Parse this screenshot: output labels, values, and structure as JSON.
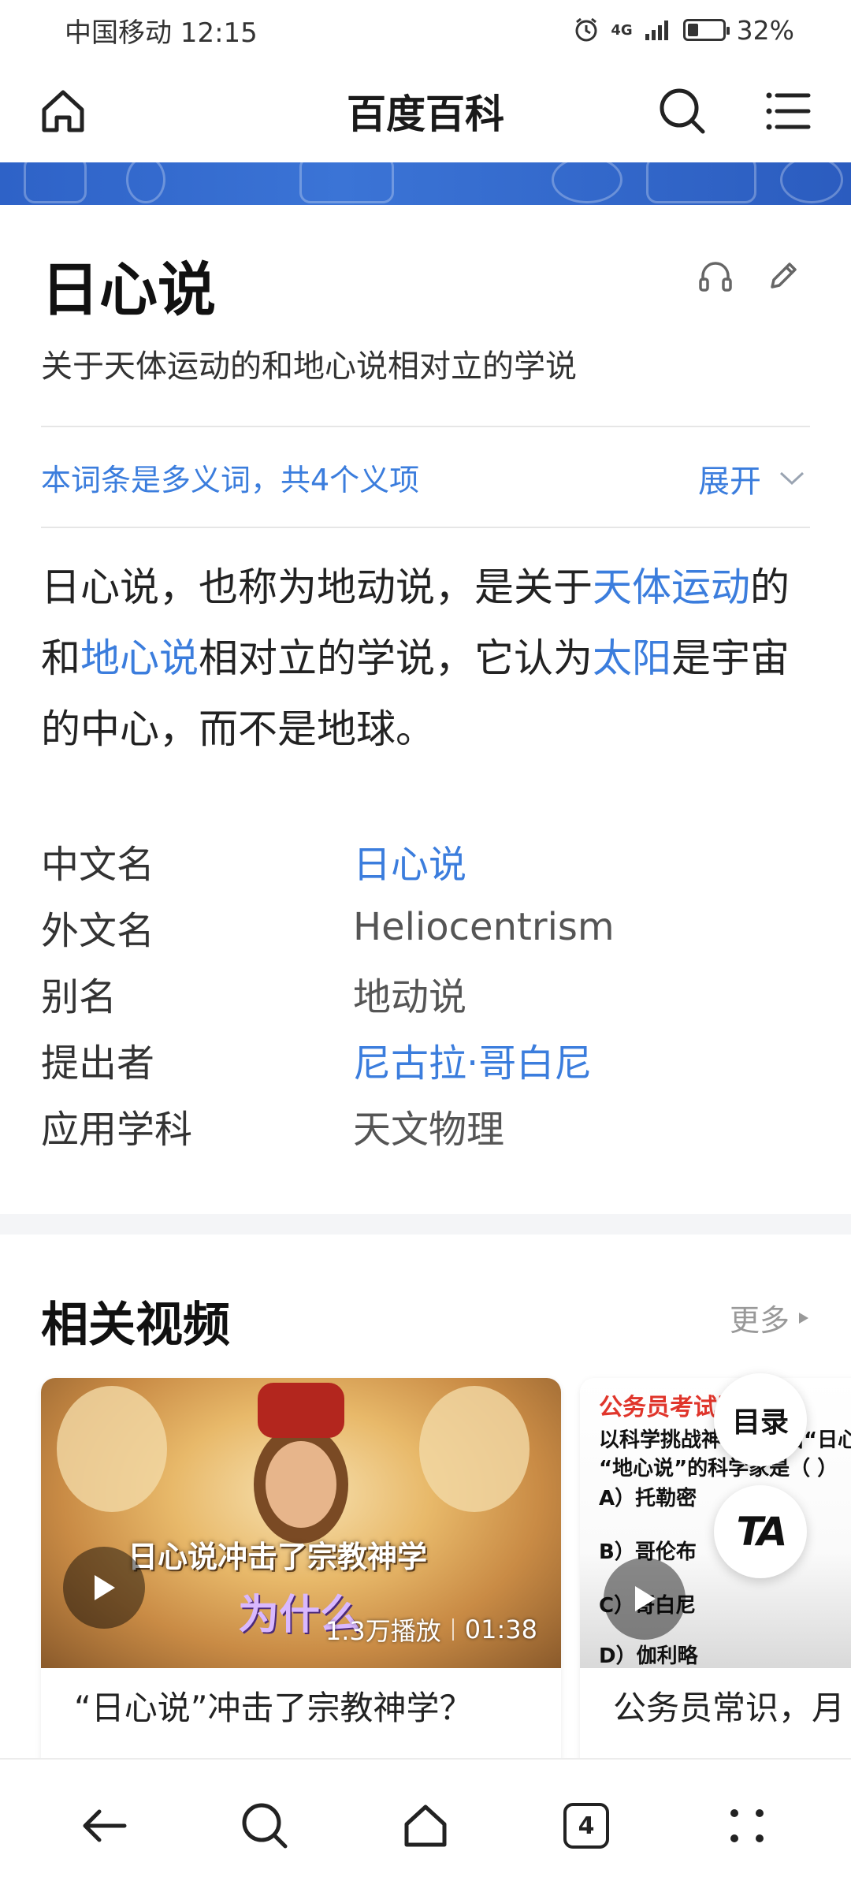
{
  "status_bar": {
    "carrier_time": "中国移动 12:15",
    "network": "4G",
    "battery_percent": "32%",
    "battery_level": 0.32
  },
  "top_nav": {
    "title": "百度百科",
    "home_icon": "home-icon",
    "search_icon": "search-icon",
    "menu_icon": "menu-icon"
  },
  "entry": {
    "title": "日心说",
    "subtitle": "关于天体运动的和地心说相对立的学说",
    "polysemy_note": "本词条是多义词，共4个义项",
    "expand_label": "展开",
    "summary": [
      {
        "text": "日心说，也称为地动说，是关于",
        "link": false
      },
      {
        "text": "天体运动",
        "link": true
      },
      {
        "text": "的和",
        "link": false
      },
      {
        "text": "地心说",
        "link": true
      },
      {
        "text": "相对立的学说，它认为",
        "link": false
      },
      {
        "text": "太阳",
        "link": true
      },
      {
        "text": "是宇宙的中心，而不是地球。",
        "link": false
      }
    ]
  },
  "infobox": [
    {
      "key": "中文名",
      "value": "日心说",
      "link": true
    },
    {
      "key": "外文名",
      "value": "Heliocentrism",
      "link": false
    },
    {
      "key": "别名",
      "value": "地动说",
      "link": false
    },
    {
      "key": "提出者",
      "value": "尼古拉·哥白尼",
      "link": true
    },
    {
      "key": "应用学科",
      "value": "天文物理",
      "link": false
    }
  ],
  "videos": {
    "section_title": "相关视频",
    "more_label": "更多",
    "items": [
      {
        "caption": "日心说冲击了宗教神学",
        "caption2": "为什么",
        "plays": "1.3万播放",
        "duration": "01:38",
        "title": "“日心说”冲击了宗教神学？"
      },
      {
        "quiz_header": "公务员考试题目",
        "quiz_question_1": "以科学挑战神学，提出“日心说",
        "quiz_question_2": "“地心说”的科学家是（ ）",
        "options": [
          "A）托勒密",
          "B）哥伦布",
          "C）哥白尼",
          "D）伽利略"
        ],
        "title": "公务员常识，月"
      }
    ]
  },
  "floating": {
    "toc_label": "目录",
    "ta_label": "TA"
  },
  "bottom_nav": {
    "tab_count": "4"
  }
}
